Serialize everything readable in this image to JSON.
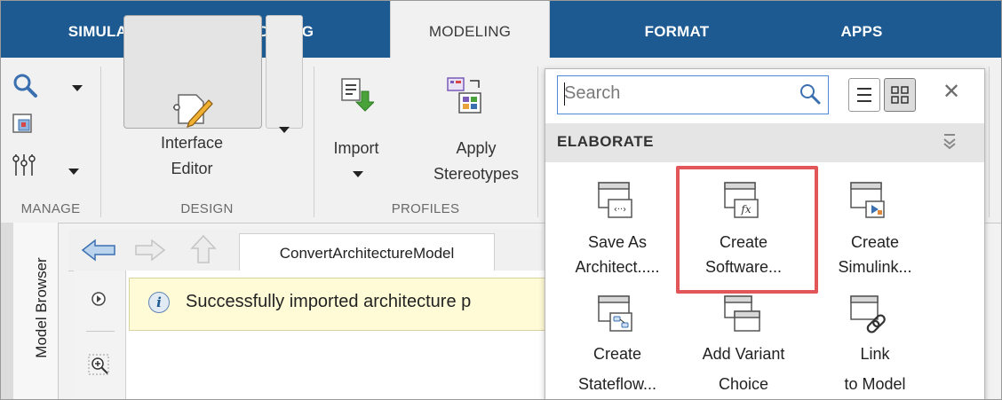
{
  "tabs": [
    {
      "label": "SIMULATION",
      "active": false
    },
    {
      "label": "DEBUG",
      "active": false
    },
    {
      "label": "MODELING",
      "active": true
    },
    {
      "label": "FORMAT",
      "active": false
    },
    {
      "label": "APPS",
      "active": false
    }
  ],
  "toolstrip": {
    "manage_label": "MANAGE",
    "design": {
      "label": "DESIGN",
      "interface_editor_line1": "Interface",
      "interface_editor_line2": "Editor"
    },
    "profiles": {
      "label": "PROFILES",
      "import_label": "Import",
      "apply_line1": "Apply",
      "apply_line2": "Stereotypes"
    }
  },
  "gallery": {
    "search_placeholder": "Search",
    "section": "ELABORATE",
    "items": [
      {
        "line1": "Save As",
        "line2": "Architect.....",
        "icon": "save-as-architecture-icon"
      },
      {
        "line1": "Create",
        "line2": "Software...",
        "icon": "create-software-icon",
        "highlighted": true
      },
      {
        "line1": "Create",
        "line2": "Simulink...",
        "icon": "create-simulink-icon"
      },
      {
        "line1": "Create",
        "line2": "Stateflow...",
        "icon": "create-stateflow-icon"
      },
      {
        "line1": "Add Variant",
        "line2": "Choice",
        "icon": "add-variant-icon"
      },
      {
        "line1": "Link",
        "line2": "to Model",
        "icon": "link-to-model-icon"
      }
    ],
    "highlight_color": "#e25558"
  },
  "editor": {
    "model_browser": "Model Browser",
    "model_tab": "ConvertArchitectureModel",
    "notice": "Successfully imported architecture p"
  },
  "colors": {
    "tab_bar": "#1d5a91",
    "accent": "#4d8ad1"
  }
}
